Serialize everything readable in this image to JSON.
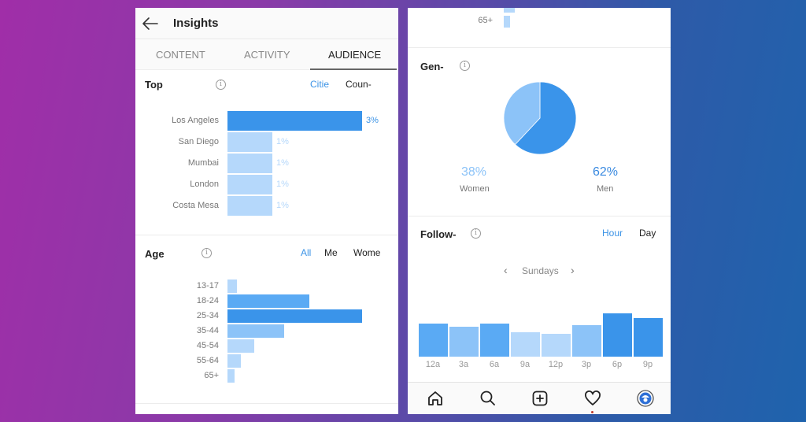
{
  "colors": {
    "dark_blue": "#3a94ea",
    "mid_blue": "#5aaaf4",
    "light_blue": "#8cc3f8",
    "pale_blue": "#b5d8fb",
    "accent_text": "#3b93e6"
  },
  "header": {
    "title": "Insights",
    "back_icon": "arrow-left-icon"
  },
  "tabs": [
    {
      "label": "CONTENT",
      "active": false
    },
    {
      "label": "ACTIVITY",
      "active": false
    },
    {
      "label": "AUDIENCE",
      "active": true
    }
  ],
  "top_locations": {
    "title": "Top",
    "toggles": [
      {
        "label": "Citie",
        "active": true
      },
      {
        "label": "Coun-",
        "active": false
      }
    ],
    "items": [
      {
        "label": "Los Angeles",
        "value": 3,
        "display": "3%"
      },
      {
        "label": "San Diego",
        "value": 1,
        "display": "1%"
      },
      {
        "label": "Mumbai",
        "value": 1,
        "display": "1%"
      },
      {
        "label": "London",
        "value": 1,
        "display": "1%"
      },
      {
        "label": "Costa Mesa",
        "value": 1,
        "display": "1%"
      }
    ]
  },
  "age_range": {
    "title": "Age",
    "toggles": [
      {
        "label": "All",
        "active": true
      },
      {
        "label": "Me",
        "active": false
      },
      {
        "label": "Wome",
        "active": false
      }
    ],
    "items": [
      {
        "label": "13-17",
        "relative": 7
      },
      {
        "label": "18-24",
        "relative": 61
      },
      {
        "label": "25-34",
        "relative": 100
      },
      {
        "label": "35-44",
        "relative": 42
      },
      {
        "label": "45-54",
        "relative": 20
      },
      {
        "label": "55-64",
        "relative": 10
      },
      {
        "label": "65+",
        "relative": 5
      }
    ],
    "overflow_visible_label": "65+"
  },
  "gender": {
    "title": "Gen-",
    "slices": [
      {
        "label": "Women",
        "value": 38,
        "display": "38%"
      },
      {
        "label": "Men",
        "value": 62,
        "display": "62%"
      }
    ]
  },
  "followers": {
    "title": "Follow-",
    "toggles": [
      {
        "label": "Hour",
        "active": true
      },
      {
        "label": "Day",
        "active": false
      }
    ],
    "day_selector": {
      "prev": "‹",
      "label": "Sundays",
      "next": "›"
    },
    "bars": [
      {
        "label": "12a",
        "relative": 76
      },
      {
        "label": "3a",
        "relative": 69
      },
      {
        "label": "6a",
        "relative": 76
      },
      {
        "label": "9a",
        "relative": 56
      },
      {
        "label": "12p",
        "relative": 53
      },
      {
        "label": "3p",
        "relative": 73
      },
      {
        "label": "6p",
        "relative": 100
      },
      {
        "label": "9p",
        "relative": 89
      }
    ]
  },
  "bottom_nav": [
    {
      "name": "home",
      "icon": "home-icon"
    },
    {
      "name": "search",
      "icon": "search-icon"
    },
    {
      "name": "new-post",
      "icon": "plus-square-icon"
    },
    {
      "name": "activity",
      "icon": "heart-icon"
    },
    {
      "name": "profile",
      "icon": "profile-avatar-icon"
    }
  ],
  "chart_data": [
    {
      "type": "bar",
      "orientation": "horizontal",
      "title": "Top Cities",
      "categories": [
        "Los Angeles",
        "San Diego",
        "Mumbai",
        "London",
        "Costa Mesa"
      ],
      "values": [
        3,
        1,
        1,
        1,
        1
      ],
      "unit": "%"
    },
    {
      "type": "bar",
      "orientation": "horizontal",
      "title": "Age Range (All)",
      "categories": [
        "13-17",
        "18-24",
        "25-34",
        "35-44",
        "45-54",
        "55-64",
        "65+"
      ],
      "values": [
        7,
        61,
        100,
        42,
        20,
        10,
        5
      ],
      "unit": "relative (max=100)"
    },
    {
      "type": "pie",
      "title": "Gender",
      "categories": [
        "Women",
        "Men"
      ],
      "values": [
        38,
        62
      ],
      "unit": "%"
    },
    {
      "type": "bar",
      "title": "Followers (Hours, Sundays)",
      "categories": [
        "12a",
        "3a",
        "6a",
        "9a",
        "12p",
        "3p",
        "6p",
        "9p"
      ],
      "values": [
        76,
        69,
        76,
        56,
        53,
        73,
        100,
        89
      ],
      "unit": "relative (max=100)"
    }
  ]
}
